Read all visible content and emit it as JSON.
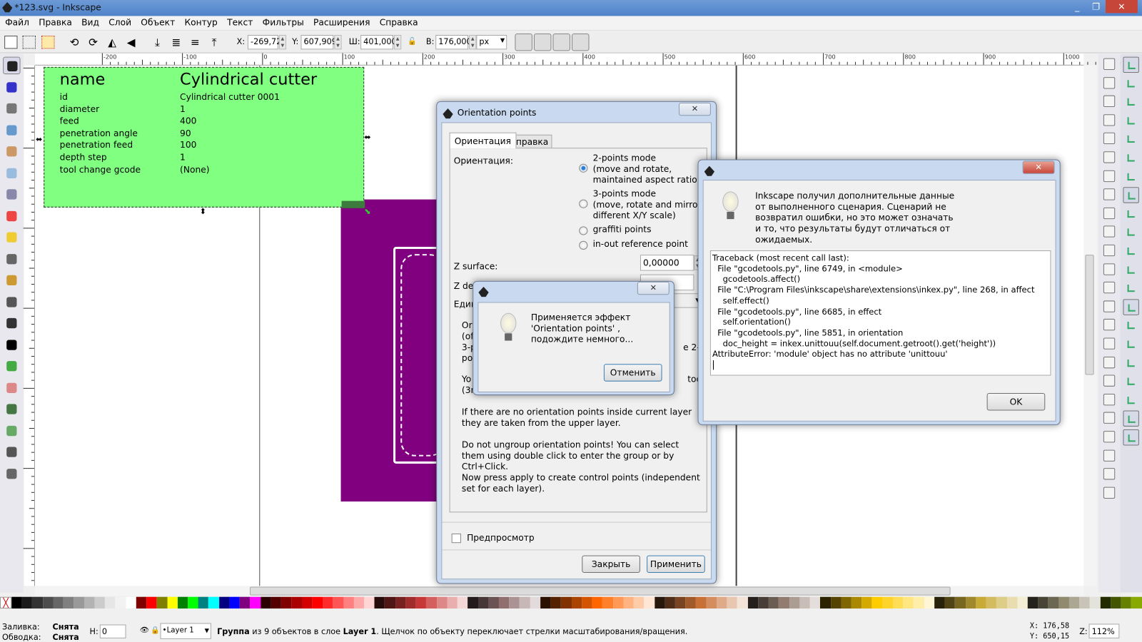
{
  "window": {
    "title": "*123.svg - Inkscape",
    "controls": [
      "minimize",
      "restore",
      "close"
    ]
  },
  "menu": [
    "Файл",
    "Правка",
    "Вид",
    "Слой",
    "Объект",
    "Контур",
    "Текст",
    "Фильтры",
    "Расширения",
    "Справка"
  ],
  "toolbar": {
    "x_label": "X:",
    "x": "-269,72€",
    "y_label": "Y:",
    "y": "607,909",
    "w_label": "Ш:",
    "w": "401,000",
    "h_label": "В:",
    "h": "176,000",
    "unit": "px"
  },
  "ruler": {
    "h_labels": [
      "-200",
      "-100",
      "0",
      "100",
      "200",
      "300",
      "400",
      "500",
      "600",
      "700",
      "800",
      "900",
      "1000"
    ]
  },
  "canvas": {
    "table": {
      "title_key": "name",
      "title_value": "Cylindrical cutter",
      "rows": [
        [
          "id",
          "Cylindrical cutter 0001"
        ],
        [
          "diameter",
          "1"
        ],
        [
          "feed",
          "400"
        ],
        [
          "penetration angle",
          "90"
        ],
        [
          "penetration feed",
          "100"
        ],
        [
          "depth step",
          "1"
        ],
        [
          "tool change gcode",
          "(None)"
        ]
      ]
    },
    "colors": {
      "table_bg": "#80ff80",
      "purple": "#800080"
    }
  },
  "orientation_dialog": {
    "title": "Orientation points",
    "tabs": [
      "Ориентация",
      "Справка"
    ],
    "orientation_label": "Ориентация:",
    "modes": [
      {
        "label": "2-points mode\n(move and rotate,\nmaintained aspect ratio X/Y)",
        "selected": true
      },
      {
        "label": "3-points mode\n(move, rotate and mirror,\ndifferent X/Y scale)",
        "selected": false
      },
      {
        "label": "graffiti points",
        "selected": false
      },
      {
        "label": "in-out reference point",
        "selected": false
      }
    ],
    "z_surface_label": "Z surface:",
    "z_surface": "0,00000",
    "z_depth_label": "Z dep",
    "units_label": "Един",
    "help_partial": [
      "Ori",
      "(of",
      "3-p",
      "po",
      "e 2-",
      "Yo",
      "(3rd",
      "tool"
    ],
    "help": [
      "If there are no orientation points inside current layer they are taken from the upper layer.",
      "Do not ungroup orientation points! You can select them using double click to enter the group or by Ctrl+Click.",
      "Now press apply to create control points (independent set for each layer)."
    ],
    "preview_label": "Предпросмотр",
    "preview_checked": false,
    "close_button": "Закрыть",
    "apply_button": "Применить"
  },
  "progress_dialog": {
    "message": "Применяется эффект 'Orientation points' , подождите немного...",
    "cancel_button": "Отменить"
  },
  "error_dialog": {
    "message": "Inkscape получил дополнительные данные от выполненного сценария. Сценарий не возвратил ошибки, но это может означать и то, что результаты будут отличаться от ожидаемых.",
    "traceback": "Traceback (most recent call last):\n  File \"gcodetools.py\", line 6749, in <module>\n    gcodetools.affect()\n  File \"C:\\Program Files\\inkscape\\share\\extensions\\inkex.py\", line 268, in affect\n    self.effect()\n  File \"gcodetools.py\", line 6685, in effect\n    self.orientation()\n  File \"gcodetools.py\", line 5851, in orientation\n    doc_height = inkex.unittouu(self.document.getroot().get('height'))\nAttributeError: 'module' object has no attribute 'unittouu'",
    "ok_button": "OK"
  },
  "status": {
    "fill_label": "Заливка:",
    "fill_value": "Снята",
    "stroke_label": "Обводка:",
    "stroke_value": "Снята",
    "h_label": "Н:",
    "h_value": "0",
    "layer": "•Layer 1",
    "message_bold": "Группа",
    "message": " из 9 объектов в слое ",
    "message_layer": "Layer 1",
    "message_tail": ". Щелчок по объекту переключает стрелки масштабирования/вращения.",
    "cursor_x": "X:  176,58",
    "cursor_y": "Y:  650,15",
    "zoom_label": "Z:",
    "zoom": "112%"
  },
  "palette": [
    "#000000",
    "#1a1a1a",
    "#333333",
    "#4d4d4d",
    "#666666",
    "#808080",
    "#999999",
    "#b3b3b3",
    "#cccccc",
    "#e6e6e6",
    "#f2f2f2",
    "#ffffff",
    "#800000",
    "#ff0000",
    "#808000",
    "#ffff00",
    "#008000",
    "#00ff00",
    "#008080",
    "#00ffff",
    "#000080",
    "#0000ff",
    "#800080",
    "#ff00ff",
    "#2b0000",
    "#550000",
    "#800000",
    "#aa0000",
    "#d40000",
    "#ff0000",
    "#ff2a2a",
    "#ff5555",
    "#ff8080",
    "#ffaaaa",
    "#ffd5d5",
    "#280b0b",
    "#501616",
    "#782121",
    "#a02c2c",
    "#c83737",
    "#d35f5f",
    "#de8787",
    "#e9afaf",
    "#f4d7d7",
    "#241c1c",
    "#483737",
    "#6c5353",
    "#916f6f",
    "#ac9393",
    "#c8b7b7",
    "#e3dbdb",
    "#2b1100",
    "#552200",
    "#803300",
    "#aa4400",
    "#d45500",
    "#ff6600",
    "#ff7f2a",
    "#ff9955",
    "#ffb380",
    "#ffccaa",
    "#ffe6d5",
    "#28170b",
    "#502d16",
    "#784421",
    "#a05a2c",
    "#c87137",
    "#d38d5f",
    "#deaa87",
    "#e9c6af",
    "#f4e3d7",
    "#241f1c",
    "#483e37",
    "#6c5d53",
    "#917c6f",
    "#ac9d93",
    "#c8beb7",
    "#e3dedb",
    "#2b2200",
    "#554400",
    "#806600",
    "#aa8800",
    "#d4aa00",
    "#ffcc00",
    "#ffd42a",
    "#ffdd55",
    "#ffe680",
    "#ffeeaa",
    "#fff6d5",
    "#28220b",
    "#504416",
    "#786721",
    "#a0892c",
    "#c8ab37",
    "#d3bc5f",
    "#decd87",
    "#e9ddaf",
    "#f4eed7",
    "#24221c",
    "#484537",
    "#6c6753",
    "#918a6f",
    "#aca793",
    "#c8c4b7",
    "#e3e2db",
    "#222b00",
    "#445500",
    "#668000",
    "#88aa00"
  ]
}
